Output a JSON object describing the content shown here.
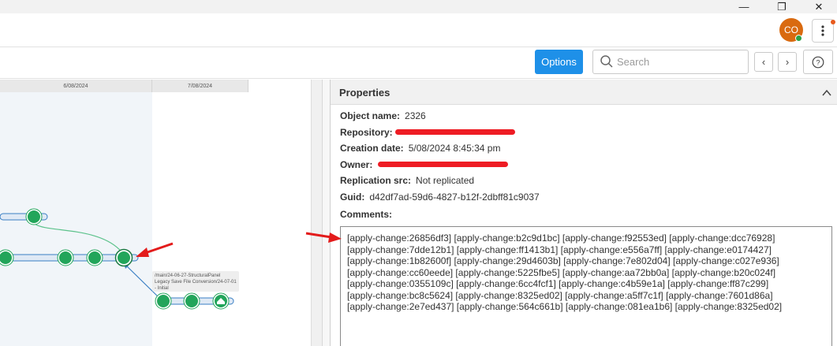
{
  "window": {
    "minimize_glyph": "—",
    "restore_glyph": "❐",
    "close_glyph": "✕"
  },
  "user": {
    "initials": "CO"
  },
  "toolbar": {
    "options_label": "Options",
    "search_placeholder": "Search",
    "prev_glyph": "‹",
    "next_glyph": "›",
    "help_glyph": "?"
  },
  "graph": {
    "dates": [
      "6/08/2024",
      "7/08/2024"
    ],
    "branch_label": "/main/24-06-27-StructuralPanel Legacy Save File Conversion/24-07-01 - Initial"
  },
  "properties": {
    "title": "Properties",
    "fields": {
      "object_name": {
        "label": "Object name:",
        "value": "2326"
      },
      "repository": {
        "label": "Repository:",
        "value": ""
      },
      "creation_date": {
        "label": "Creation date:",
        "value": "5/08/2024 8:45:34 pm"
      },
      "owner": {
        "label": "Owner:",
        "value": ""
      },
      "replication_src": {
        "label": "Replication src:",
        "value": "Not replicated"
      },
      "guid": {
        "label": "Guid:",
        "value": "d42df7ad-59d6-4827-b12f-2dbff81c9037"
      },
      "comments": {
        "label": "Comments:"
      }
    },
    "comments_text": "[apply-change:26856df3] [apply-change:b2c9d1bc] [apply-change:f92553ed] [apply-change:dcc76928]\n[apply-change:7dde12b1] [apply-change:ff1413b1] [apply-change:e556a7ff] [apply-change:e0174427]\n[apply-change:1b82600f] [apply-change:29d4603b] [apply-change:7e802d04] [apply-change:c027e936]\n[apply-change:cc60eede] [apply-change:5225fbe5] [apply-change:aa72bb0a] [apply-change:b20c024f]\n[apply-change:0355109c] [apply-change:6cc4fcf1] [apply-change:c4b59e1a] [apply-change:ff87c299]\n[apply-change:bc8c5624] [apply-change:8325ed02] [apply-change:a5ff7c1f] [apply-change:7601d86a]\n[apply-change:2e7ed437] [apply-change:564c661b] [apply-change:081ea1b6] [apply-change:8325ed02]"
  },
  "colors": {
    "accent": "#1e90e8",
    "changeset_green": "#22a55a",
    "avatar": "#d96a10",
    "redaction": "#ee1c24"
  }
}
